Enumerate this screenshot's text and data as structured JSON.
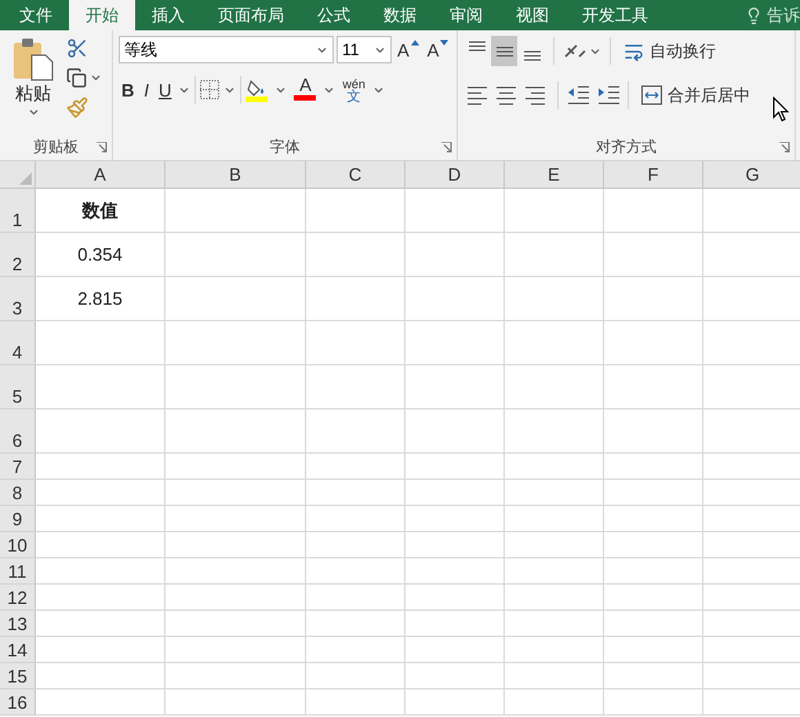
{
  "tabs": [
    {
      "label": "文件",
      "selected": false
    },
    {
      "label": "开始",
      "selected": true
    },
    {
      "label": "插入",
      "selected": false
    },
    {
      "label": "页面布局",
      "selected": false
    },
    {
      "label": "公式",
      "selected": false
    },
    {
      "label": "数据",
      "selected": false
    },
    {
      "label": "审阅",
      "selected": false
    },
    {
      "label": "视图",
      "selected": false
    },
    {
      "label": "开发工具",
      "selected": false
    }
  ],
  "tell_me": "告诉",
  "clipboard": {
    "paste_label": "粘贴",
    "group_label": "剪贴板"
  },
  "font": {
    "name": "等线",
    "size": "11",
    "grow_label": "A",
    "shrink_label": "A",
    "bold_label": "B",
    "italic_label": "I",
    "underline_label": "U",
    "font_color_label": "A",
    "phonetic_top": "wén",
    "phonetic_bottom": "文",
    "group_label": "字体"
  },
  "alignment": {
    "vertical": [
      {
        "kind": "top",
        "selected": false
      },
      {
        "kind": "middle",
        "selected": true
      },
      {
        "kind": "bottom",
        "selected": false
      }
    ],
    "horizontal": [
      {
        "kind": "left",
        "selected": false
      },
      {
        "kind": "center",
        "selected": false
      },
      {
        "kind": "right",
        "selected": false
      }
    ],
    "wrap_text": "自动换行",
    "merge_center": "合并后居中",
    "group_label": "对齐方式"
  },
  "sheet": {
    "columns": [
      "A",
      "B",
      "C",
      "D",
      "E",
      "F",
      "G"
    ],
    "rows": [
      {
        "label": "1",
        "cells": [
          {
            "text": "数值",
            "kind": "header"
          }
        ]
      },
      {
        "label": "2",
        "cells": [
          {
            "text": "0.354",
            "kind": "number"
          }
        ]
      },
      {
        "label": "3",
        "cells": [
          {
            "text": "2.815",
            "kind": "number"
          }
        ]
      },
      {
        "label": "4",
        "cells": []
      },
      {
        "label": "5",
        "cells": []
      },
      {
        "label": "6",
        "cells": []
      },
      {
        "label": "7",
        "cells": []
      },
      {
        "label": "8",
        "cells": []
      },
      {
        "label": "9",
        "cells": []
      },
      {
        "label": "10",
        "cells": []
      },
      {
        "label": "11",
        "cells": []
      },
      {
        "label": "12",
        "cells": []
      },
      {
        "label": "13",
        "cells": []
      },
      {
        "label": "14",
        "cells": []
      },
      {
        "label": "15",
        "cells": []
      },
      {
        "label": "16",
        "cells": []
      }
    ]
  }
}
